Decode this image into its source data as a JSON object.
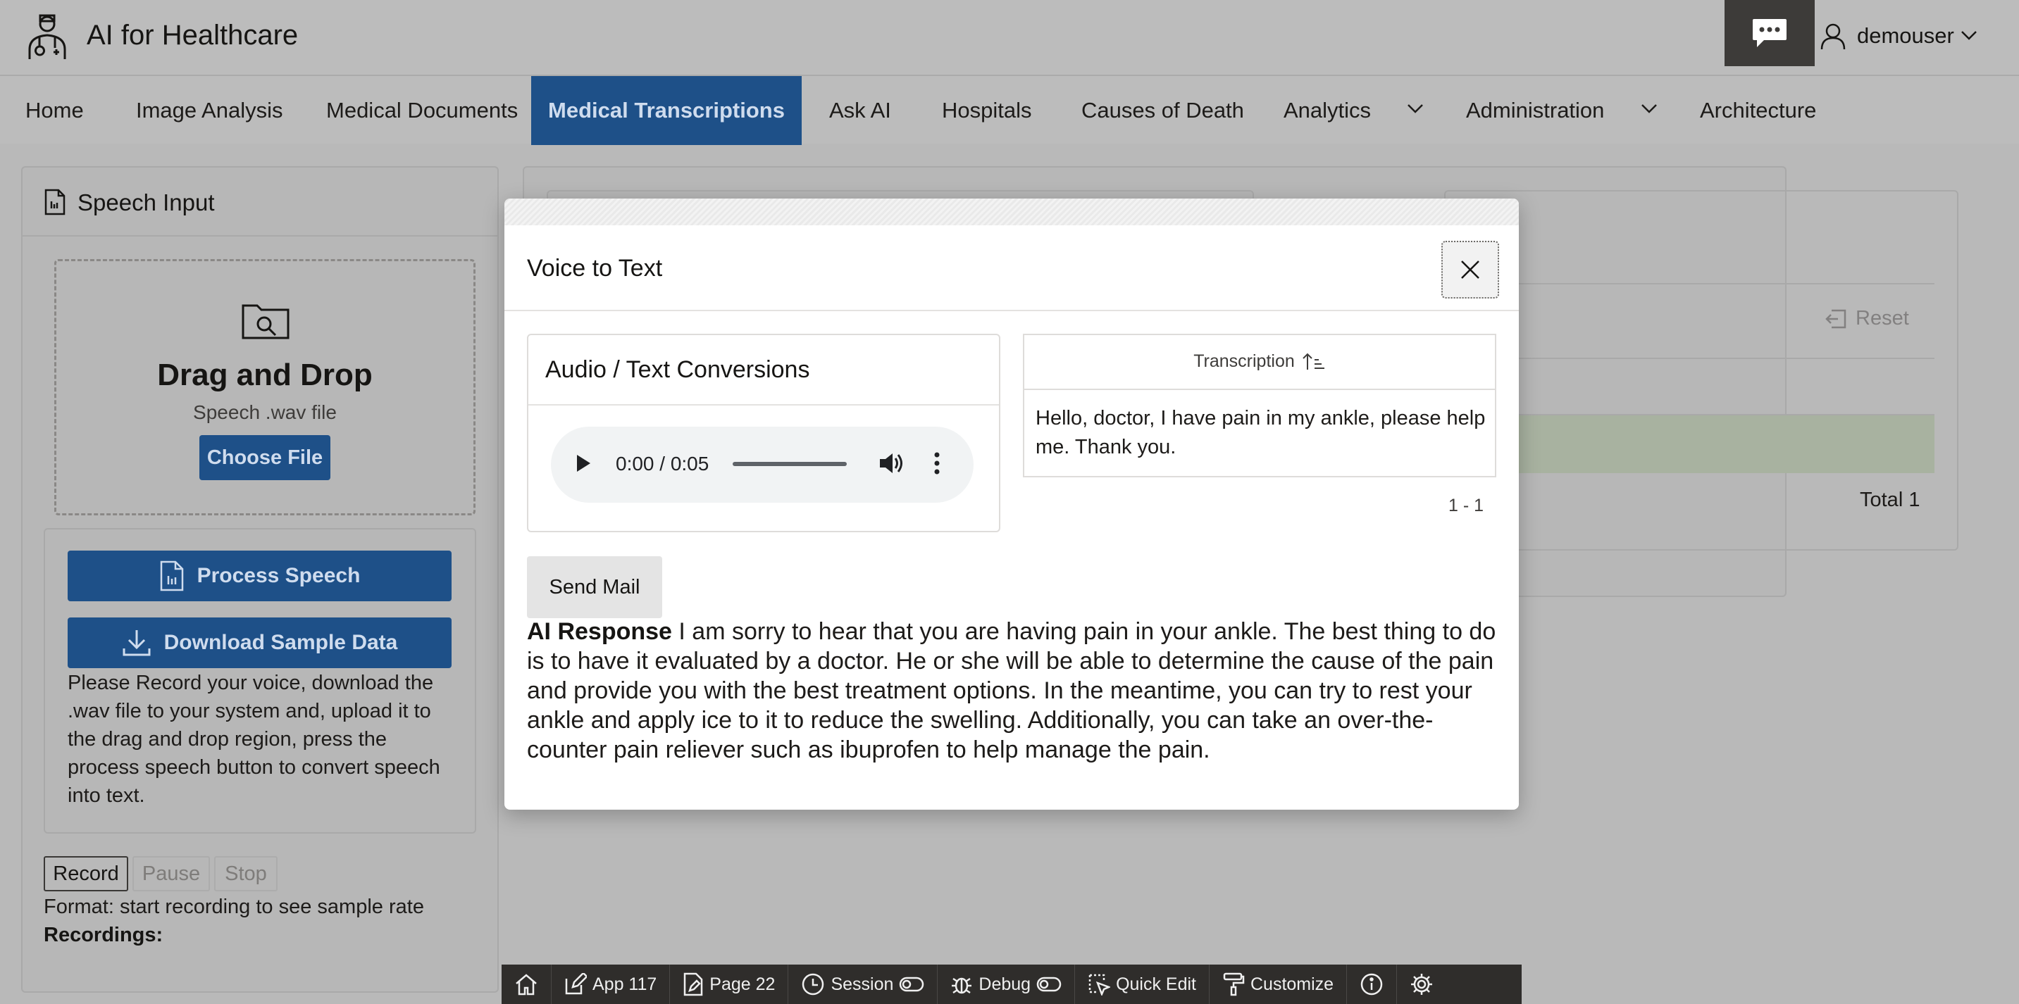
{
  "app": {
    "title": "AI for Healthcare",
    "user": "demouser"
  },
  "nav": {
    "items": [
      {
        "label": "Home"
      },
      {
        "label": "Image Analysis"
      },
      {
        "label": "Medical Documents"
      },
      {
        "label": "Medical Transcriptions",
        "active": true
      },
      {
        "label": "Ask AI"
      },
      {
        "label": "Hospitals"
      },
      {
        "label": "Causes of Death"
      },
      {
        "label": "Analytics",
        "has_menu": true
      },
      {
        "label": "Administration",
        "has_menu": true
      },
      {
        "label": "Architecture"
      }
    ]
  },
  "speech_panel": {
    "title": "Speech Input",
    "dropzone_title": "Drag and Drop",
    "dropzone_subtitle": "Speech .wav file",
    "choose_file": "Choose File",
    "process_button": "Process Speech",
    "download_button": "Download Sample Data",
    "instructions": "Please Record your voice, download the .wav file to your system and, upload it to the drag and drop region, press the process speech button to convert speech into text.",
    "record": "Record",
    "pause": "Pause",
    "stop": "Stop",
    "format_text": "Format: start recording to see sample rate",
    "recordings_label": "Recordings:"
  },
  "background_report": {
    "reset": "Reset",
    "total": "Total 1"
  },
  "modal": {
    "title": "Voice to Text",
    "conversions_title": "Audio / Text Conversions",
    "audio_time": "0:00 / 0:05",
    "transcription_header": "Transcription",
    "transcription_text": "Hello, doctor, I have pain in my ankle, please help me. Thank you.",
    "pagination": "1 - 1",
    "send_mail": "Send Mail",
    "ai_response_label": "AI Response",
    "ai_response_text": "I am sorry to hear that you are having pain in your ankle. The best thing to do is to have it evaluated by a doctor. He or she will be able to determine the cause of the pain and provide you with the best treatment options. In the meantime, you can try to rest your ankle and apply ice to it to reduce the swelling. Additionally, you can take an over-the-counter pain reliever such as ibuprofen to help manage the pain."
  },
  "dev_toolbar": {
    "app": "App 117",
    "page": "Page 22",
    "session": "Session",
    "debug": "Debug",
    "quick_edit": "Quick Edit",
    "customize": "Customize"
  },
  "colors": {
    "accent": "#1e5088",
    "overlay": "#b9b9b9",
    "toolbar": "#2f2d2b"
  }
}
